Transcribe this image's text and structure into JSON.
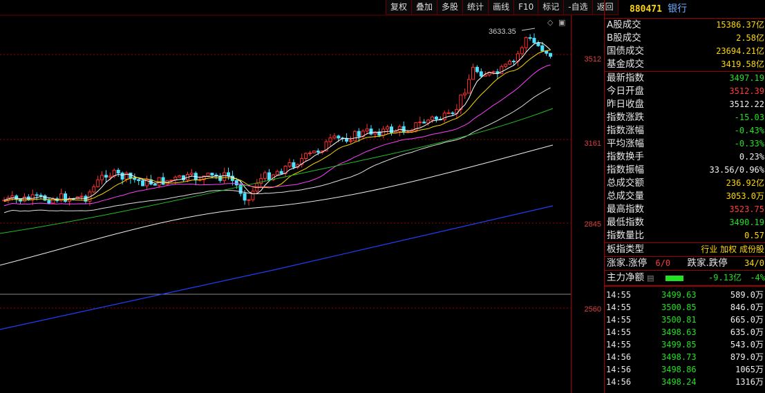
{
  "toolbar": [
    "复权",
    "叠加",
    "多股",
    "统计",
    "画线",
    "F10",
    "标记",
    "-自选",
    "返回"
  ],
  "axis_labels": [
    "3512",
    "3161",
    "2845",
    "2560"
  ],
  "chart": {
    "peak_label": "3633.35"
  },
  "header": {
    "code": "880471",
    "name": "银行"
  },
  "volumes": [
    {
      "label": "A股成交",
      "value": "15386.37亿",
      "color": "yellow"
    },
    {
      "label": "B股成交",
      "value": "2.58亿",
      "color": "yellow"
    },
    {
      "label": "国债成交",
      "value": "23694.21亿",
      "color": "yellow"
    },
    {
      "label": "基金成交",
      "value": "3419.58亿",
      "color": "yellow"
    }
  ],
  "stats": [
    {
      "label": "最新指数",
      "value": "3497.19",
      "color": "green"
    },
    {
      "label": "今日开盘",
      "value": "3512.39",
      "color": "red"
    },
    {
      "label": "昨日收盘",
      "value": "3512.22",
      "color": "white"
    },
    {
      "label": "指数涨跌",
      "value": "-15.03",
      "color": "green"
    },
    {
      "label": "指数涨幅",
      "value": "-0.43%",
      "color": "green"
    },
    {
      "label": "平均涨幅",
      "value": "-0.33%",
      "color": "green"
    },
    {
      "label": "指数换手",
      "value": "0.23%",
      "color": "white"
    },
    {
      "label": "指数振幅",
      "value": "33.56/0.96%",
      "color": "white"
    },
    {
      "label": "总成交额",
      "value": "236.92亿",
      "color": "yellow"
    },
    {
      "label": "总成交量",
      "value": "3053.0万",
      "color": "yellow"
    },
    {
      "label": "最高指数",
      "value": "3523.75",
      "color": "red"
    },
    {
      "label": "最低指数",
      "value": "3490.19",
      "color": "green"
    },
    {
      "label": "指数量比",
      "value": "0.57",
      "color": "yellow"
    }
  ],
  "board": {
    "label": "板指类型",
    "value": "行业 加权 成份股"
  },
  "breadth": {
    "up_label": "涨家.涨停",
    "up_value": "6/0",
    "down_label": "跌家.跌停",
    "down_value": "34/0"
  },
  "netflow": {
    "label": "主力净额",
    "value": "-9.13亿",
    "pct": "-4%"
  },
  "trades": [
    {
      "time": "14:55",
      "price": "3499.63",
      "qty": "589.0万"
    },
    {
      "time": "14:55",
      "price": "3500.85",
      "qty": "846.0万"
    },
    {
      "time": "14:55",
      "price": "3500.81",
      "qty": "665.0万"
    },
    {
      "time": "14:55",
      "price": "3498.63",
      "qty": "635.0万"
    },
    {
      "time": "14:55",
      "price": "3499.85",
      "qty": "543.0万"
    },
    {
      "time": "14:56",
      "price": "3498.73",
      "qty": "879.0万"
    },
    {
      "time": "14:56",
      "price": "3498.86",
      "qty": "1065万"
    },
    {
      "time": "14:56",
      "price": "3498.24",
      "qty": "1316万"
    }
  ]
}
